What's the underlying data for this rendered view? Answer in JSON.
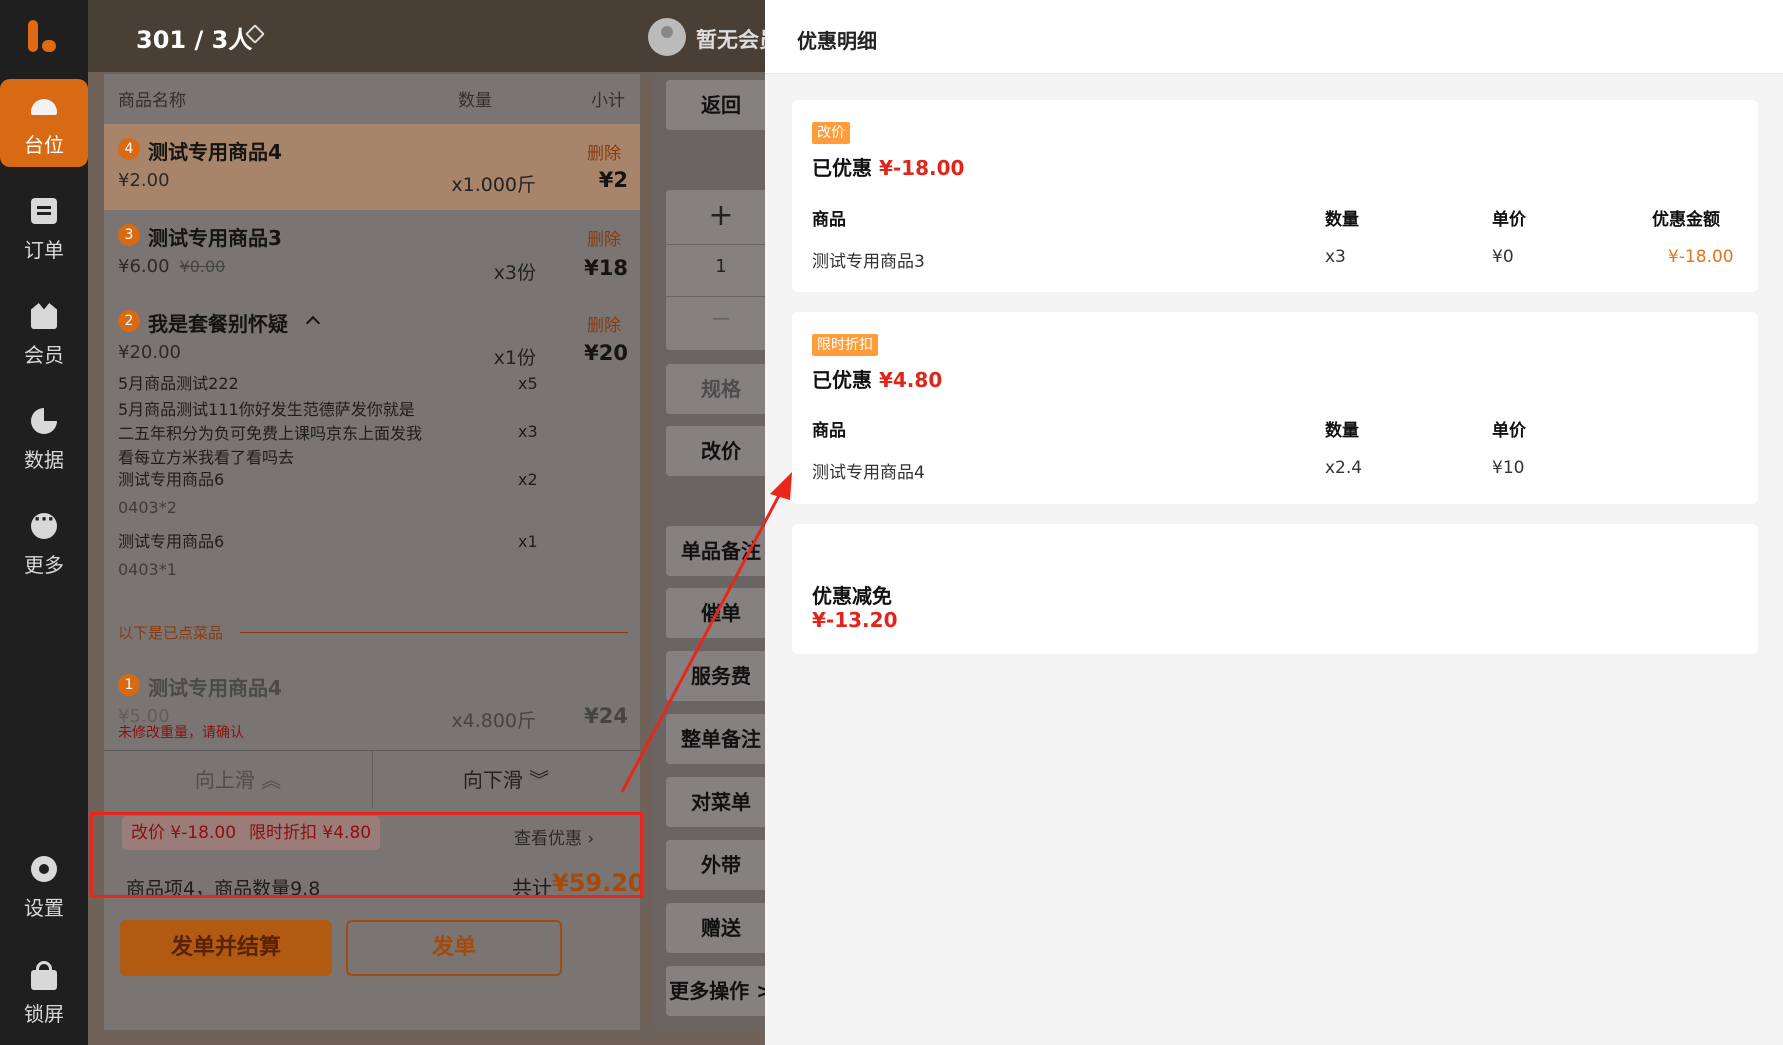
{
  "nav": {
    "items": [
      {
        "label": "台位",
        "icon": "table-bell-icon"
      },
      {
        "label": "订单",
        "icon": "order-icon"
      },
      {
        "label": "会员",
        "icon": "crown-icon"
      },
      {
        "label": "数据",
        "icon": "pie-chart-icon"
      },
      {
        "label": "更多",
        "icon": "more-icon"
      }
    ],
    "settings": "设置",
    "lock": "锁屏"
  },
  "header": {
    "table": "301 / 3人",
    "member": "暂无会员"
  },
  "order": {
    "col_name": "商品名称",
    "col_qty": "数量",
    "col_subtotal": "小计",
    "items": [
      {
        "index": "4",
        "name": "测试专用商品4",
        "price": "¥2.00",
        "qty": "x1.000斤",
        "subtotal": "¥2",
        "delete": "删除"
      },
      {
        "index": "3",
        "name": "测试专用商品3",
        "price": "¥6.00",
        "orig_price": "¥0.00",
        "qty": "x3份",
        "subtotal": "¥18",
        "delete": "删除"
      },
      {
        "index": "2",
        "name": "我是套餐别怀疑",
        "price": "¥20.00",
        "qty": "x1份",
        "subtotal": "¥20",
        "delete": "删除"
      }
    ],
    "combo_items": [
      {
        "name": "5月商品测试222",
        "qty": "x5"
      },
      {
        "name": "5月商品测试111你好发生范德萨发你就是二五年积分为负可免费上课吗京东上面发我看每立方米我看了看吗去",
        "qty": "x3"
      },
      {
        "name": "测试专用商品6",
        "qty": "x2",
        "note": "0403*2"
      },
      {
        "name": "测试专用商品6",
        "qty": "x1",
        "note": "0403*1"
      }
    ],
    "ordered_divider": "以下是已点菜品",
    "ordered_item": {
      "index": "1",
      "name": "测试专用商品4",
      "price": "¥5.00",
      "qty": "x4.800斤",
      "subtotal": "¥24",
      "warning": "未修改重量，请确认"
    },
    "scroll_up": "向上滑",
    "scroll_down": "向下滑",
    "promo_chips": [
      "改价 ¥-18.00",
      "限时折扣 ¥4.80"
    ],
    "view_promo": "查看优惠",
    "summary": "商品项4，商品数量9.8",
    "total_label": "共计",
    "total": "¥59.20",
    "btn_settle": "发单并结算",
    "btn_send": "发单"
  },
  "actions": {
    "back": "返回",
    "plus": "+",
    "qty": "1",
    "minus": "—",
    "spec": "规格",
    "change_price": "改价",
    "item_note": "单品备注",
    "rush": "催单",
    "service_fee": "服务费",
    "order_note": "整单备注",
    "check_menu": "对菜单",
    "takeout": "外带",
    "gift": "赠送",
    "more": "更多操作 >"
  },
  "drawer": {
    "title": "优惠明细",
    "cards": [
      {
        "tag": "改价",
        "saved_label": "已优惠",
        "saved_amount": "¥-18.00",
        "headers": [
          "商品",
          "数量",
          "单价",
          "优惠金额"
        ],
        "row": [
          "测试专用商品3",
          "x3",
          "¥0",
          "¥-18.00"
        ]
      },
      {
        "tag": "限时折扣",
        "saved_label": "已优惠",
        "saved_amount": "¥4.80",
        "headers": [
          "商品",
          "数量",
          "单价"
        ],
        "row": [
          "测试专用商品4",
          "x2.4",
          "¥10"
        ]
      }
    ],
    "reduction": {
      "label": "优惠减免",
      "amount": "¥-13.20"
    }
  }
}
